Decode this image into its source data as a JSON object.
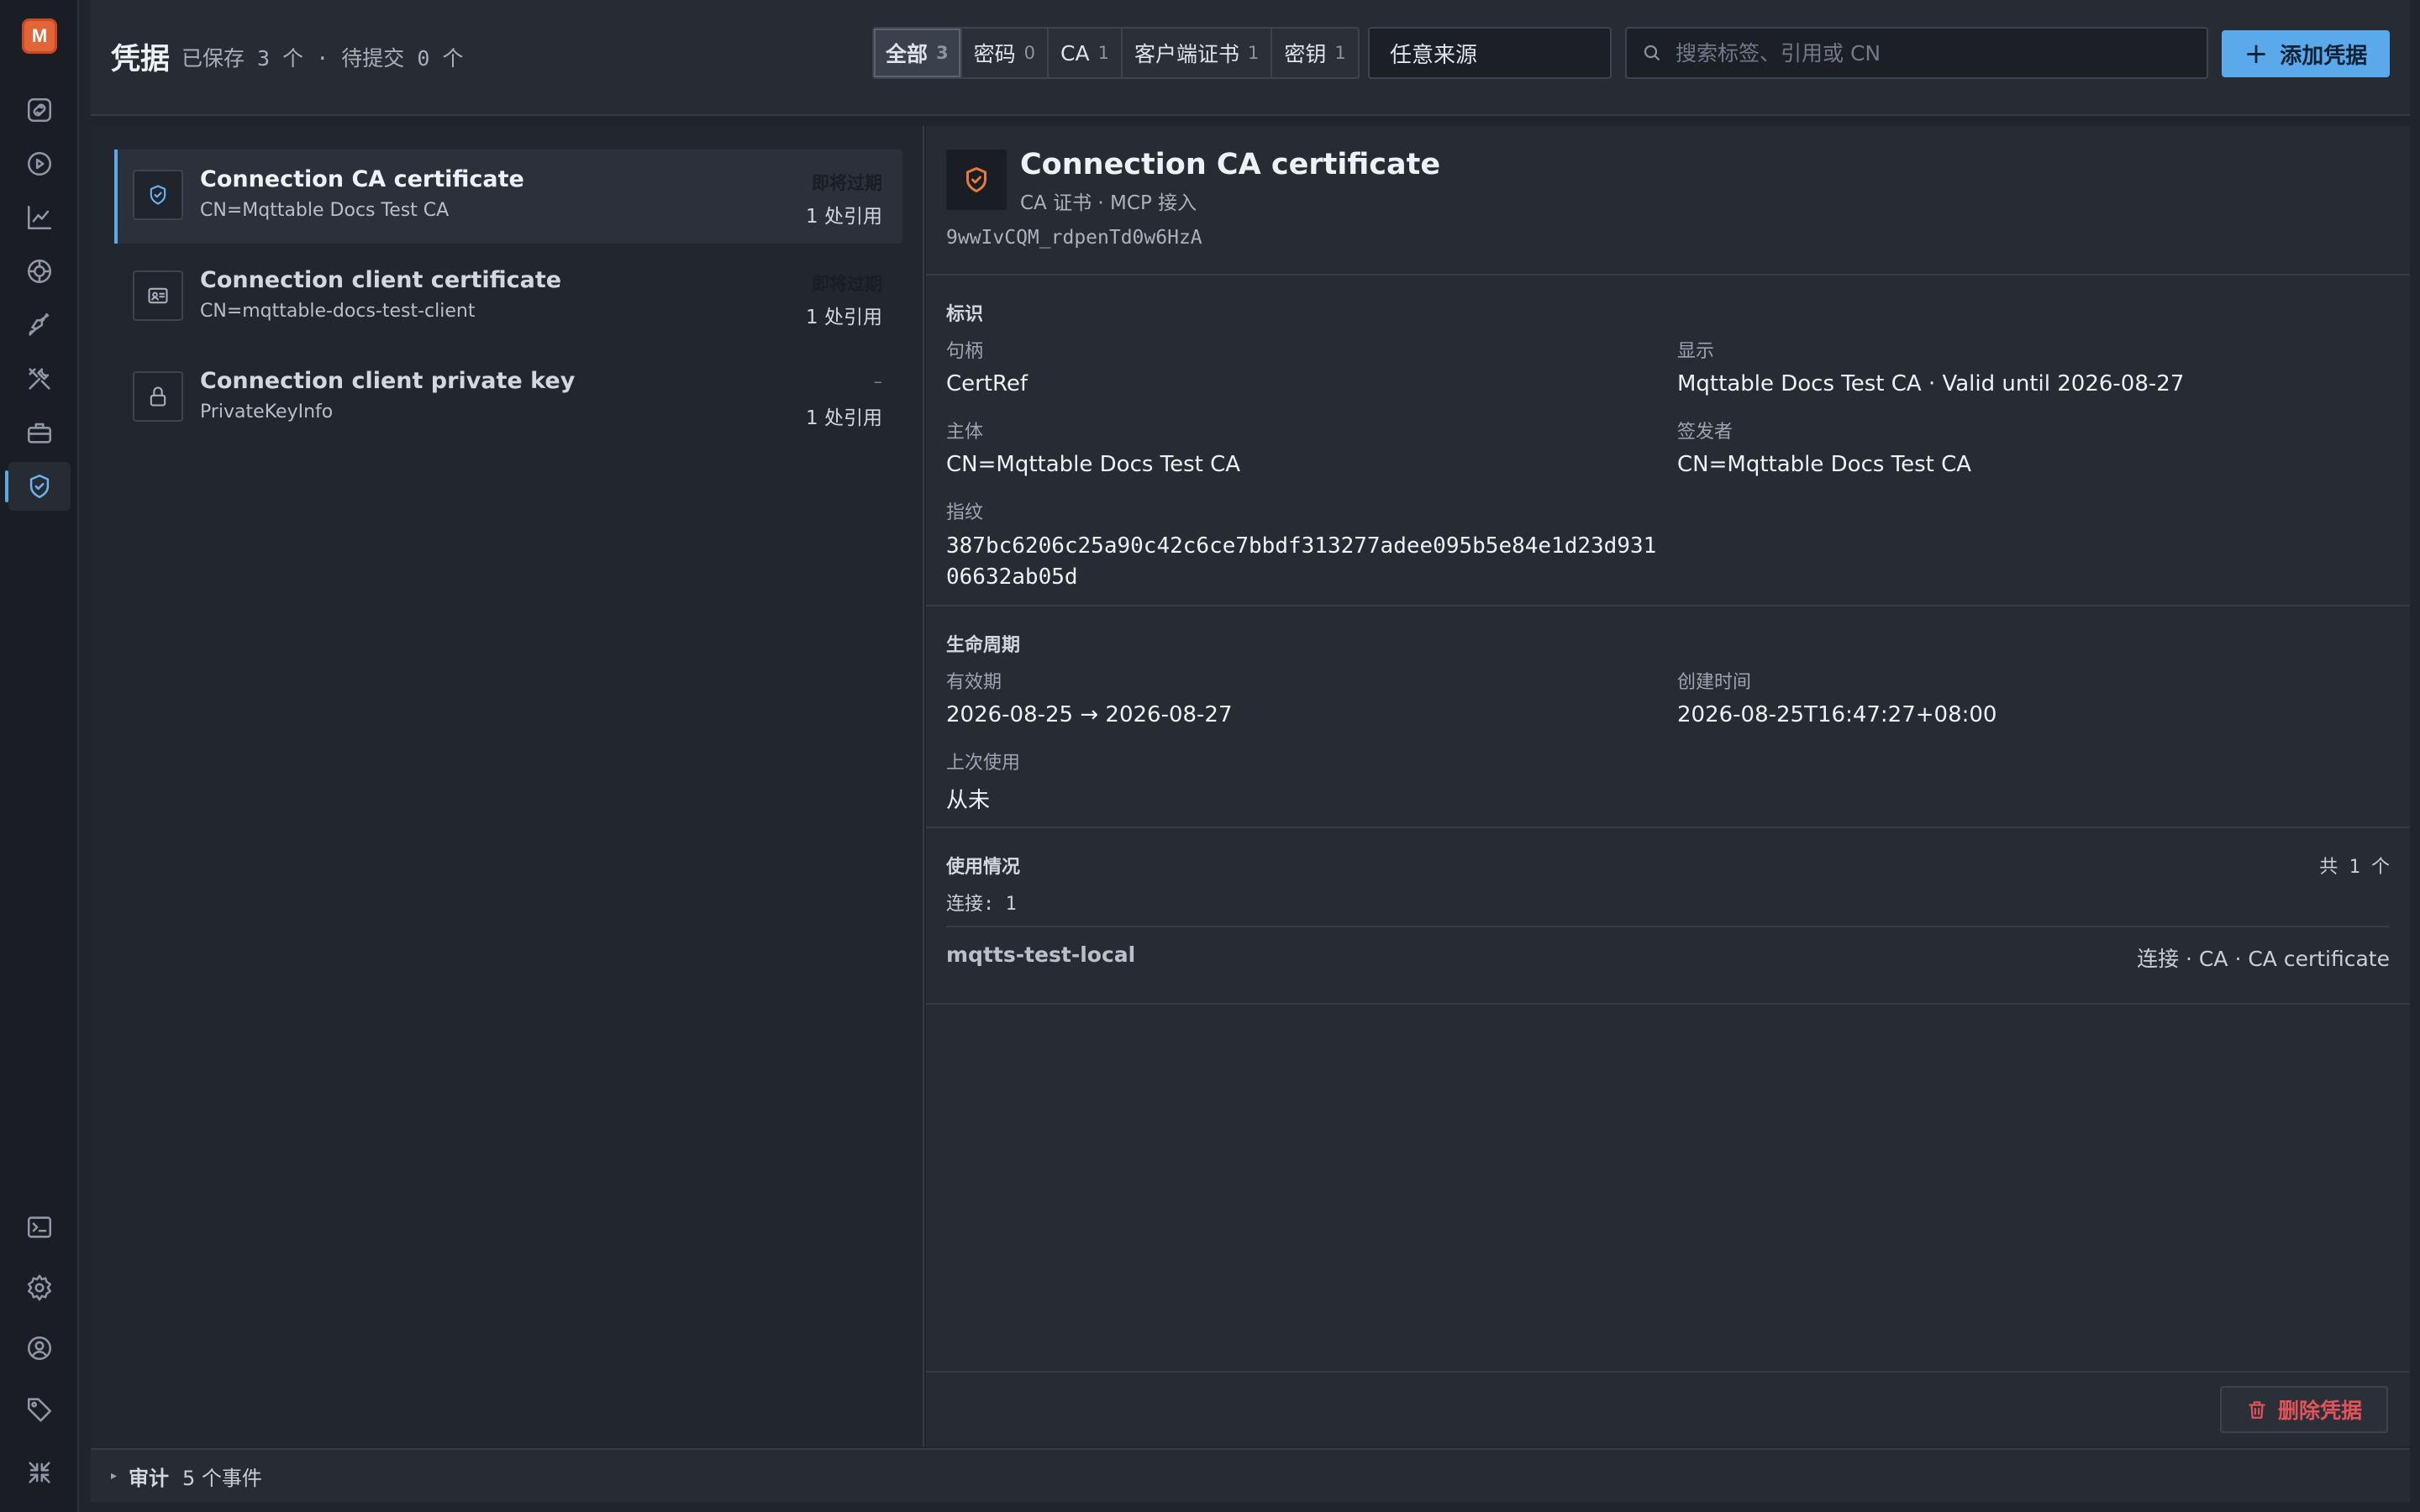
{
  "app": {
    "logo_letter": "M"
  },
  "header": {
    "title": "凭据",
    "stats": "已保存 3 个 · 待提交 0 个",
    "filters": [
      {
        "label": "全部",
        "count": "3"
      },
      {
        "label": "密码",
        "count": "0"
      },
      {
        "label": "CA",
        "count": "1"
      },
      {
        "label": "客户端证书",
        "count": "1"
      },
      {
        "label": "密钥",
        "count": "1"
      }
    ],
    "source_select": "任意来源",
    "search_placeholder": "搜索标签、引用或 CN",
    "add_label": "添加凭据"
  },
  "list": [
    {
      "name": "Connection CA certificate",
      "sub": "CN=Mqttable Docs Test CA",
      "status": "即将过期",
      "refs": "1 处引用",
      "icon": "shield-check-icon"
    },
    {
      "name": "Connection client certificate",
      "sub": "CN=mqttable-docs-test-client",
      "status": "即将过期",
      "refs": "1 处引用",
      "icon": "id-card-icon"
    },
    {
      "name": "Connection client private key",
      "sub": "PrivateKeyInfo",
      "status": "–",
      "refs": "1 处引用",
      "icon": "lock-icon"
    }
  ],
  "detail": {
    "title": "Connection CA certificate",
    "subtitle": "CA 证书 · MCP 接入",
    "id": "9wwIvCQM_rdpenTd0w6HzA",
    "identity": {
      "heading": "标识",
      "handle_label": "句柄",
      "handle": "CertRef",
      "display_label": "显示",
      "display": "Mqttable Docs Test CA · Valid until 2026-08-27",
      "subject_label": "主体",
      "subject": "CN=Mqttable Docs Test CA",
      "issuer_label": "签发者",
      "issuer": "CN=Mqttable Docs Test CA",
      "fingerprint_label": "指纹",
      "fingerprint": "387bc6206c25a90c42c6ce7bbdf313277adee095b5e84e1d23d93106632ab05d"
    },
    "lifecycle": {
      "heading": "生命周期",
      "validity_label": "有效期",
      "validity": "2026-08-25 → 2026-08-27",
      "created_label": "创建时间",
      "created": "2026-08-25T16:47:27+08:00",
      "last_used_label": "上次使用",
      "last_used": "从未"
    },
    "usage": {
      "heading": "使用情况",
      "total": "共 1 个",
      "connections": "连接: 1",
      "rows": [
        {
          "name": "mqtts-test-local",
          "desc": "连接 · CA · CA certificate"
        }
      ]
    },
    "delete_label": "删除凭据"
  },
  "audit": {
    "label": "审计",
    "count": "5 个事件"
  }
}
